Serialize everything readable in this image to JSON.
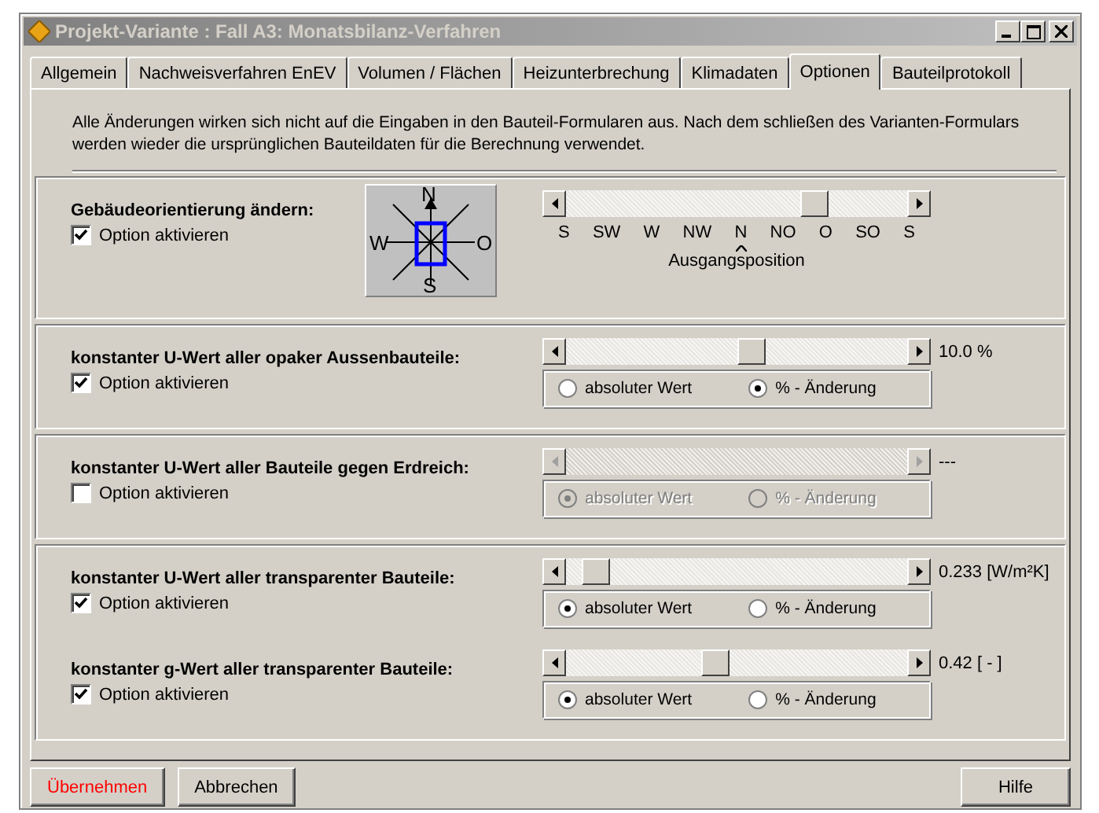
{
  "window": {
    "title": "Projekt-Variante : Fall A3: Monatsbilanz-Verfahren"
  },
  "tabs": [
    {
      "label": "Allgemein",
      "selected": false
    },
    {
      "label": "Nachweisverfahren EnEV",
      "selected": false
    },
    {
      "label": "Volumen / Flächen",
      "selected": false
    },
    {
      "label": "Heizunterbrechung",
      "selected": false
    },
    {
      "label": "Klimadaten",
      "selected": false
    },
    {
      "label": "Optionen",
      "selected": true
    },
    {
      "label": "Bauteilprotokoll",
      "selected": false
    }
  ],
  "info": "Alle  Änderungen wirken sich nicht auf die Eingaben in den Bauteil-Formularen aus. Nach dem schließen des Varianten-Formulars werden wieder die ursprünglichen Bauteildaten für die Berechnung verwendet.",
  "groups": [
    {
      "options": [
        {
          "kind": "compass",
          "title": "Gebäudeorientierung ändern:",
          "checkbox": "Option aktivieren",
          "checked": true,
          "disabled": false,
          "level": 0.75,
          "compass": {
            "north": "N",
            "west": "W",
            "east": "O",
            "south": "S"
          },
          "scale": [
            {
              "label": "S",
              "origin": false
            },
            {
              "label": "SW",
              "origin": false
            },
            {
              "label": "W",
              "origin": false
            },
            {
              "label": "NW",
              "origin": false
            },
            {
              "label": "N",
              "origin": true
            },
            {
              "label": "NO",
              "origin": false
            },
            {
              "label": "O",
              "origin": false
            },
            {
              "label": "SO",
              "origin": false
            },
            {
              "label": "S",
              "origin": false
            }
          ],
          "origin_label": "Ausgangsposition"
        }
      ]
    },
    {
      "options": [
        {
          "kind": "radios",
          "title": "konstanter U-Wert aller opaker Aussenbauteile:",
          "checkbox": "Option aktivieren",
          "checked": true,
          "disabled": false,
          "level": 0.55,
          "value": "10.0 %",
          "radios": [
            {
              "label": "absoluter Wert",
              "selected": false
            },
            {
              "label": "% - Änderung",
              "selected": true
            }
          ]
        }
      ]
    },
    {
      "options": [
        {
          "kind": "radios",
          "title": "konstanter U-Wert aller Bauteile gegen Erdreich:",
          "checkbox": "Option aktivieren",
          "checked": false,
          "disabled": true,
          "value": "---",
          "radios": [
            {
              "label": "absoluter Wert",
              "selected": true
            },
            {
              "label": "% - Änderung",
              "selected": false
            }
          ]
        }
      ]
    },
    {
      "options": [
        {
          "kind": "radios",
          "title": "konstanter U-Wert aller transparenter Bauteile:",
          "checkbox": "Option aktivieren",
          "checked": true,
          "disabled": false,
          "level": 0.05,
          "value": "0.233 [W/m²K]",
          "radios": [
            {
              "label": "absoluter Wert",
              "selected": true
            },
            {
              "label": "% - Änderung",
              "selected": false
            }
          ]
        },
        {
          "kind": "radios",
          "title": "konstanter g-Wert aller transparenter Bauteile:",
          "checkbox": "Option aktivieren",
          "checked": true,
          "disabled": false,
          "level": 0.43,
          "value": "0.42 [ - ]",
          "radios": [
            {
              "label": "absoluter Wert",
              "selected": true
            },
            {
              "label": "% - Änderung",
              "selected": false
            }
          ]
        }
      ]
    }
  ],
  "buttons": [
    {
      "label": "Übernehmen",
      "kind": "primary"
    },
    {
      "label": "Abbrechen",
      "kind": "normal"
    },
    {
      "label": "Hilfe",
      "kind": "normal"
    }
  ]
}
